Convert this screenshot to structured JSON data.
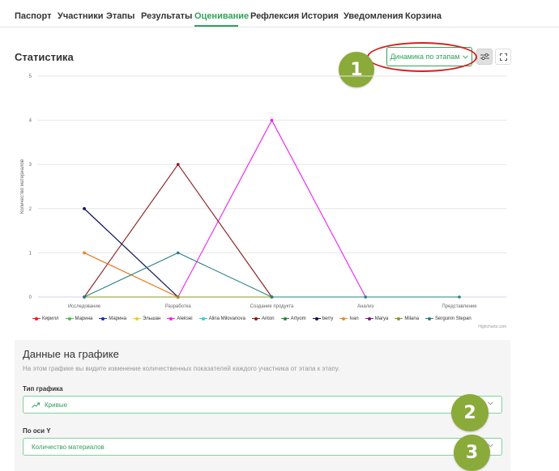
{
  "tabs": [
    "Паспорт",
    "Участники",
    "Этапы",
    "Результаты",
    "Оценивание",
    "Рефлексия",
    "История",
    "Уведомления",
    "Корзина"
  ],
  "active_tab": "Оценивание",
  "header": {
    "title": "Статистика",
    "dynamics_button": "Динамика по этапам",
    "filter_icon": "sliders-icon",
    "fullscreen_icon": "fullscreen-icon"
  },
  "markers": [
    "1",
    "2",
    "3"
  ],
  "chart_data": {
    "type": "line",
    "categories": [
      "Исследование",
      "Разработка",
      "Создание продукта",
      "Анализ",
      "Представление"
    ],
    "ylabel": "Количество материалов",
    "ylim": [
      0,
      5
    ],
    "yticks": [
      "0",
      "1",
      "2",
      "3",
      "4",
      "5"
    ],
    "credits": "Highcharts.com",
    "series": [
      {
        "name": "Кирилл",
        "color": "#e8201e",
        "values": [
          1,
          0,
          0,
          null,
          null
        ]
      },
      {
        "name": "Марина",
        "color": "#4cbf4c",
        "values": [
          0,
          0,
          0,
          null,
          null
        ]
      },
      {
        "name": "Марина",
        "color": "#1b2cc4",
        "values": [
          2,
          0,
          0,
          null,
          null
        ]
      },
      {
        "name": "Эльшан",
        "color": "#e6d21e",
        "values": [
          0,
          0,
          0,
          null,
          null
        ]
      },
      {
        "name": "Aleksei",
        "color": "#f01ef0",
        "values": [
          0,
          0,
          4,
          0,
          null
        ]
      },
      {
        "name": "Alina Milovanova",
        "color": "#31d0d0",
        "values": [
          0,
          0,
          0,
          null,
          null
        ]
      },
      {
        "name": "Anton",
        "color": "#8b1a1a",
        "values": [
          0,
          3,
          0,
          null,
          null
        ]
      },
      {
        "name": "Artyom",
        "color": "#1f8a3a",
        "values": [
          0,
          0,
          0,
          null,
          null
        ]
      },
      {
        "name": "berry",
        "color": "#141450",
        "values": [
          2,
          0,
          0,
          null,
          null
        ]
      },
      {
        "name": "Ivan",
        "color": "#e88a2a",
        "values": [
          1,
          0,
          0,
          null,
          null
        ]
      },
      {
        "name": "Marya",
        "color": "#7a1a7a",
        "values": [
          0,
          0,
          0,
          null,
          null
        ]
      },
      {
        "name": "Milana",
        "color": "#8a9a2a",
        "values": [
          0,
          0,
          0,
          null,
          null
        ]
      },
      {
        "name": "Sergunin Stepan",
        "color": "#2a8080",
        "values": [
          0,
          1,
          0,
          0,
          0
        ]
      }
    ]
  },
  "panel": {
    "title": "Данные на графике",
    "description": "На этом графике вы видите изменение количественных показателей каждого участника от этапа к этапу.",
    "chart_type_label": "Тип графика",
    "chart_type_value": "Кривые",
    "axis_label": "По оси Y",
    "axis_value": "Количество материалов"
  }
}
